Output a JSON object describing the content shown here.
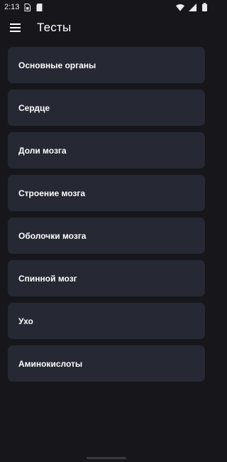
{
  "status": {
    "time": "2:13",
    "icons": [
      "sim-icon",
      "sd-card-icon",
      "wifi-icon",
      "signal-icon",
      "battery-icon"
    ]
  },
  "app_bar": {
    "menu_icon": "hamburger-menu-icon",
    "title": "Тесты"
  },
  "tests": [
    {
      "label": "Основные органы"
    },
    {
      "label": "Сердце"
    },
    {
      "label": "Доли мозга"
    },
    {
      "label": "Строение мозга"
    },
    {
      "label": "Оболочки мозга"
    },
    {
      "label": "Спинной мозг"
    },
    {
      "label": "Ухо"
    },
    {
      "label": "Аминокислоты"
    }
  ],
  "colors": {
    "background": "#17171b",
    "card": "#262833",
    "text": "#ffffff"
  }
}
